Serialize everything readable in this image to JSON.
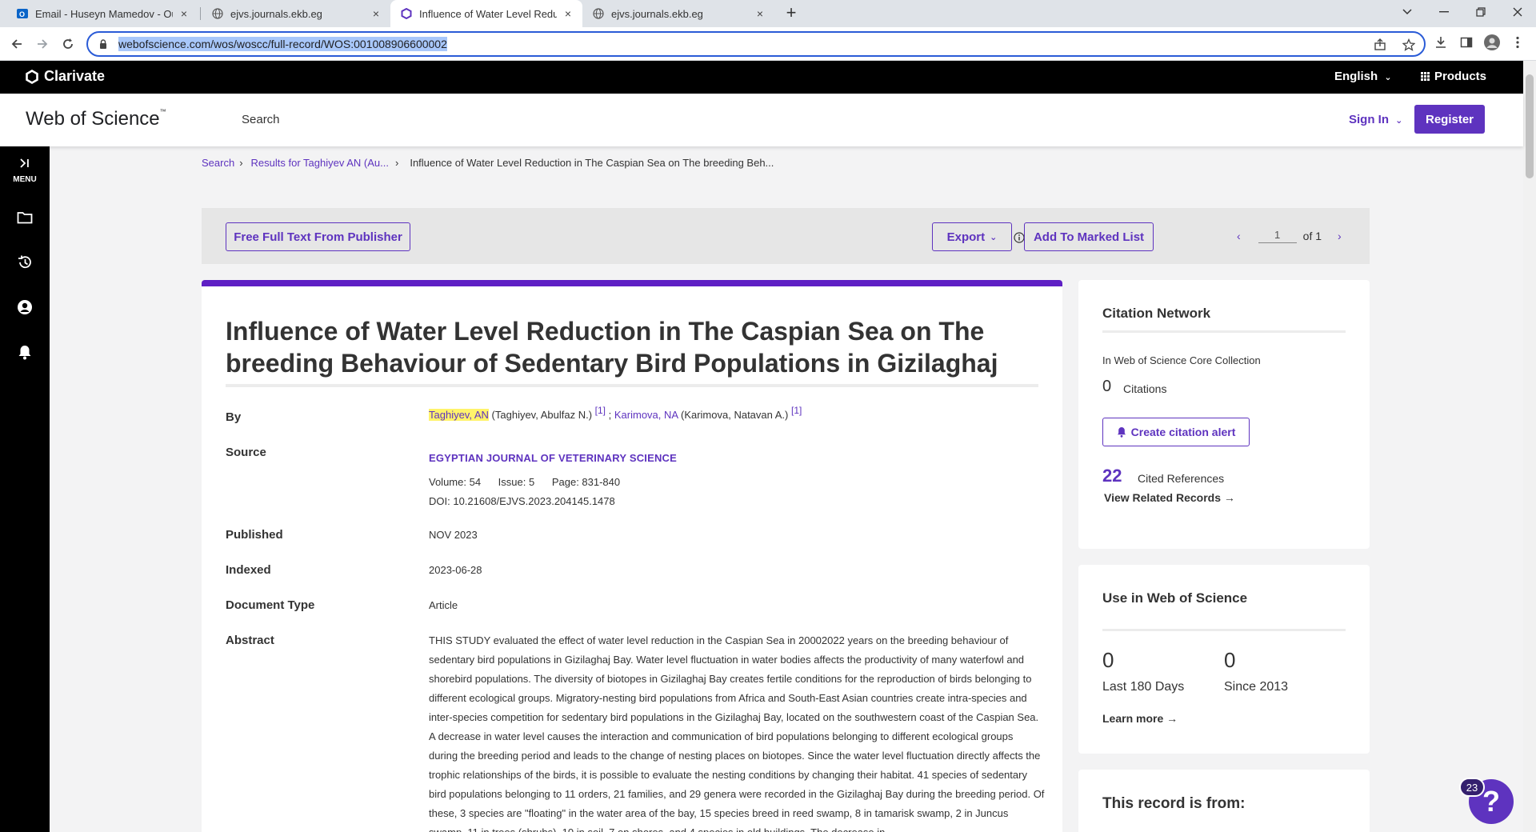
{
  "browser": {
    "tabs": [
      {
        "label": "Email - Huseyn Mamedov - Outlook",
        "icon": "outlook-icon"
      },
      {
        "label": "ejvs.journals.ekb.eg",
        "icon": "globe-icon"
      },
      {
        "label": "Influence of Water Level Reduction",
        "icon": "clarivate-icon"
      },
      {
        "label": "ejvs.journals.ekb.eg",
        "icon": "globe-icon"
      }
    ],
    "close_glyph": "×",
    "new_tab_glyph": "+",
    "url": "webofscience.com/wos/woscc/full-record/WOS:001008906600002"
  },
  "clarivate_bar": {
    "logo": "Clarivate",
    "language": "English",
    "products": "Products"
  },
  "header": {
    "logo": "Web of Science",
    "logo_tm": "™",
    "search": "Search",
    "sign_in": "Sign In",
    "register": "Register"
  },
  "sidebar": {
    "menu_label": "MENU"
  },
  "breadcrumb": {
    "items": [
      "Search",
      "Results for Taghiyev AN (Au...",
      "Influence of Water Level Reduction in The Caspian Sea on The breeding Beh..."
    ]
  },
  "actionbar": {
    "free_full_text": "Free Full Text From Publisher",
    "export": "Export",
    "add_to_marked_list": "Add To Marked List",
    "page_current": "1",
    "page_total": "of 1"
  },
  "record": {
    "title": "Influence of Water Level Reduction in The Caspian Sea on The breeding Behaviour of Sedentary Bird Populations in Gizilaghaj",
    "labels": {
      "by": "By",
      "source": "Source",
      "published": "Published",
      "indexed": "Indexed",
      "doc_type": "Document Type",
      "abstract": "Abstract"
    },
    "authors": [
      {
        "short": "Taghiyev, AN",
        "full": "(Taghiyev, Abulfaz N.)",
        "ref": "[1]"
      },
      {
        "short": "Karimova, NA",
        "full": "(Karimova, Natavan A.)",
        "ref": "[1]"
      }
    ],
    "author_separator": ";",
    "journal": "EGYPTIAN JOURNAL OF VETERINARY SCIENCE",
    "volume": "Volume: 54",
    "issue": "Issue: 5",
    "pages": "Page: 831-840",
    "doi": "DOI: 10.21608/EJVS.2023.204145.1478",
    "published": "NOV 2023",
    "indexed": "2023-06-28",
    "doc_type": "Article",
    "abstract": "THIS STUDY evaluated the effect of water level reduction in the Caspian Sea in 20002022 years on the breeding behaviour of sedentary bird populations in Gizilaghaj Bay. Water level fluctuation in water bodies affects the productivity of many waterfowl and shorebird populations. The diversity of biotopes in Gizilaghaj Bay creates fertile conditions for the reproduction of birds belonging to different ecological groups. Migratory-nesting bird populations from Africa and South-East Asian countries create intra-species and inter-species competition for sedentary bird populations in the Gizilaghaj Bay, located on the southwestern coast of the Caspian Sea. A decrease in water level causes the interaction and communication of bird populations belonging to different ecological groups during the breeding period and leads to the change of nesting places on biotopes. Since the water level fluctuation directly affects the trophic relationships of the birds, it is possible to evaluate the nesting conditions by changing their habitat. 41 species of sedentary bird populations belonging to 11 orders, 21 families, and 29 genera were recorded in the Gizilaghaj Bay during the breeding period. Of these, 3 species are \"floating\" in the water area of the bay, 15 species breed in reed swamp, 8 in tamarisk swamp, 2 in Juncus swamp, 11 in trees (shrubs), 10 in soil, 7 on shores, and 4 species in old buildings. The decrease in"
  },
  "citation_network": {
    "title": "Citation Network",
    "collection": "In Web of Science Core Collection",
    "citations_count": "0",
    "citations_label": "Citations",
    "alert_button": "Create citation alert",
    "cited_refs_count": "22",
    "cited_refs_label": "Cited References",
    "related_link": "View Related Records →"
  },
  "usage": {
    "title": "Use in Web of Science",
    "last180_count": "0",
    "last180_label": "Last 180 Days",
    "since2013_count": "0",
    "since2013_label": "Since 2013",
    "learn_more": "Learn more →"
  },
  "record_from": {
    "title": "This record is from:"
  },
  "help": {
    "badge": "23",
    "glyph": "?"
  },
  "colors": {
    "accent": "#5e33bf",
    "highlight": "#fff36b",
    "dark_bar": "#000000"
  }
}
